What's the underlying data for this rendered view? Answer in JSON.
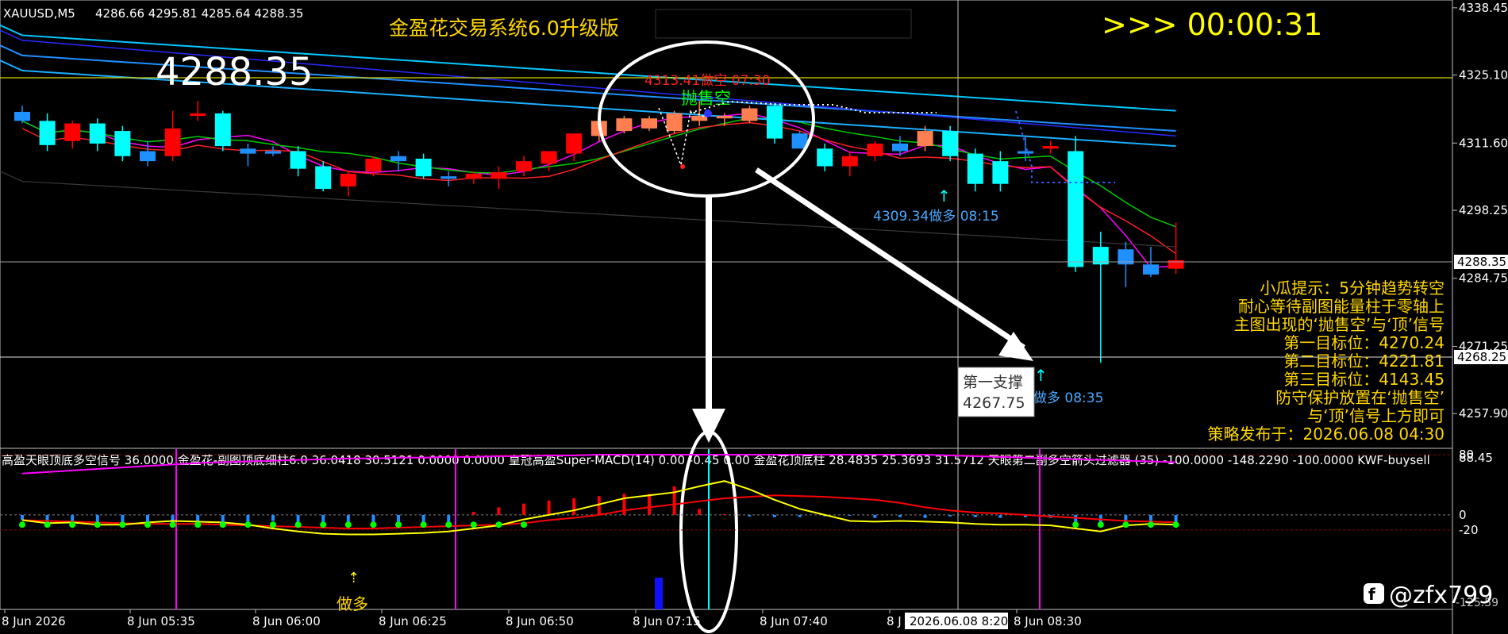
{
  "header": {
    "symbol": "XAUUSD,M5",
    "ohlc": "4286.66 4295.81 4285.64 4288.35",
    "system_title": "金盈花交易系统6.0升级版",
    "countdown": ">>> 00:00:31",
    "big_price": "4288.35"
  },
  "price_axis": {
    "ticks": [
      "4338.45",
      "4325.10",
      "4311.60",
      "4298.25",
      "4284.75",
      "4271.25",
      "4257.90"
    ],
    "current_tag": "4288.35",
    "line_tag": "4268.25"
  },
  "signals": {
    "sell_text": "4313.41做空 07:30",
    "sell_label": "抛售空",
    "buy1_text": "4309.34做多 08:15",
    "buy2_text": "做多 08:35",
    "support_title": "第一支撑",
    "support_value": "4267.75",
    "sub_buy_label": "做多"
  },
  "tips": {
    "line1": "小瓜提示：5分钟趋势转空",
    "line2": "耐心等待副图能量柱于零轴上",
    "line3": "主图出现的‘抛售空’与‘顶’信号",
    "line4": "第一目标位：4270.24",
    "line5": "第二目标位：4221.81",
    "line6": "第三目标位：4143.45",
    "line7": "防守保护放置在‘抛售空’",
    "line8": "与‘顶’信号上方即可",
    "line9": "策略发布于：2026.06.08 04:30"
  },
  "sub_header": "高盈天眼顶底多空信号 36.0000  金盈花-副图顶底细柱6.0 36.0418 30.5121 0.0000 0.0000  皇冠高盈Super-MACD(14) 0.00 -0.45 0.00  金盈花顶底柱 28.4835 25.3693 31.5712  天眼第二副多空箭头过滤器 (35) -100.0000 -148.2290 -100.0000  KWF-buysell",
  "sub_axis": {
    "ticks": [
      "88.45",
      "80",
      "0",
      "-20"
    ],
    "bottom": "-125.59"
  },
  "time_axis": {
    "labels": [
      "8 Jun 2026",
      "8 Jun 05:35",
      "8 Jun 06:00",
      "8 Jun 06:25",
      "8 Jun 06:50",
      "8 Jun 07:15",
      "8 Jun 07:40",
      "8 J",
      "8 Jun 08:30"
    ],
    "cursor_label": "2026.06.08 8:20"
  },
  "watermark": "@zfx799",
  "colors": {
    "up": "#ff0000",
    "down": "#1e90ff",
    "cyan": "#00ffff",
    "yellow": "#ffd700"
  },
  "chart_data": {
    "type": "candlestick",
    "timeframe": "M5",
    "candles": [
      {
        "o": 4317.8,
        "h": 4319.0,
        "l": 4315.5,
        "c": 4316.0
      },
      {
        "o": 4316.0,
        "h": 4317.5,
        "l": 4310.0,
        "c": 4311.2
      },
      {
        "o": 4312.0,
        "h": 4316.0,
        "l": 4310.5,
        "c": 4315.5
      },
      {
        "o": 4315.5,
        "h": 4316.5,
        "l": 4310.0,
        "c": 4311.5
      },
      {
        "o": 4314.0,
        "h": 4315.0,
        "l": 4308.0,
        "c": 4309.0
      },
      {
        "o": 4310.0,
        "h": 4312.0,
        "l": 4307.0,
        "c": 4308.0
      },
      {
        "o": 4309.0,
        "h": 4318.0,
        "l": 4308.0,
        "c": 4314.5
      },
      {
        "o": 4317.0,
        "h": 4320.0,
        "l": 4316.0,
        "c": 4317.5
      },
      {
        "o": 4317.5,
        "h": 4318.0,
        "l": 4310.0,
        "c": 4311.0
      },
      {
        "o": 4310.5,
        "h": 4311.5,
        "l": 4307.0,
        "c": 4309.5
      },
      {
        "o": 4310.0,
        "h": 4311.0,
        "l": 4309.0,
        "c": 4309.5
      },
      {
        "o": 4310.0,
        "h": 4311.0,
        "l": 4305.0,
        "c": 4306.5
      },
      {
        "o": 4307.0,
        "h": 4308.0,
        "l": 4302.0,
        "c": 4302.5
      },
      {
        "o": 4303.0,
        "h": 4306.0,
        "l": 4301.0,
        "c": 4305.5
      },
      {
        "o": 4306.0,
        "h": 4309.0,
        "l": 4305.0,
        "c": 4308.5
      },
      {
        "o": 4309.0,
        "h": 4310.0,
        "l": 4306.0,
        "c": 4308.0
      },
      {
        "o": 4308.5,
        "h": 4309.5,
        "l": 4304.5,
        "c": 4305.0
      },
      {
        "o": 4305.0,
        "h": 4306.0,
        "l": 4303.0,
        "c": 4304.5
      },
      {
        "o": 4304.5,
        "h": 4306.0,
        "l": 4303.5,
        "c": 4305.5
      },
      {
        "o": 4304.5,
        "h": 4307.0,
        "l": 4302.5,
        "c": 4305.8
      },
      {
        "o": 4306.0,
        "h": 4309.0,
        "l": 4305.0,
        "c": 4308.0
      },
      {
        "o": 4307.5,
        "h": 4310.0,
        "l": 4306.0,
        "c": 4310.0
      },
      {
        "o": 4309.5,
        "h": 4312.5,
        "l": 4308.0,
        "c": 4313.5
      },
      {
        "o": 4313.0,
        "h": 4316.0,
        "l": 4312.0,
        "c": 4316.0
      },
      {
        "o": 4314.0,
        "h": 4317.0,
        "l": 4313.5,
        "c": 4316.5
      },
      {
        "o": 4314.5,
        "h": 4317.0,
        "l": 4314.0,
        "c": 4316.5
      },
      {
        "o": 4314.0,
        "h": 4318.0,
        "l": 4313.5,
        "c": 4317.5
      },
      {
        "o": 4316.0,
        "h": 4320.0,
        "l": 4315.0,
        "c": 4317.0
      },
      {
        "o": 4316.5,
        "h": 4317.5,
        "l": 4315.0,
        "c": 4317.0
      },
      {
        "o": 4316.0,
        "h": 4319.0,
        "l": 4315.5,
        "c": 4318.5
      },
      {
        "o": 4319.0,
        "h": 4319.5,
        "l": 4311.5,
        "c": 4312.5
      },
      {
        "o": 4313.5,
        "h": 4314.0,
        "l": 4311.0,
        "c": 4310.5
      },
      {
        "o": 4310.5,
        "h": 4311.5,
        "l": 4306.0,
        "c": 4307.0
      },
      {
        "o": 4307.0,
        "h": 4310.0,
        "l": 4305.0,
        "c": 4309.0
      },
      {
        "o": 4309.0,
        "h": 4312.0,
        "l": 4308.0,
        "c": 4311.5
      },
      {
        "o": 4311.5,
        "h": 4313.0,
        "l": 4309.0,
        "c": 4310.0
      },
      {
        "o": 4311.0,
        "h": 4315.0,
        "l": 4310.0,
        "c": 4314.0
      },
      {
        "o": 4314.0,
        "h": 4315.0,
        "l": 4308.0,
        "c": 4309.0
      },
      {
        "o": 4309.5,
        "h": 4310.5,
        "l": 4302.0,
        "c": 4303.5
      },
      {
        "o": 4308.0,
        "h": 4310.0,
        "l": 4302.0,
        "c": 4303.5
      },
      {
        "o": 4310.0,
        "h": 4313.0,
        "l": 4308.0,
        "c": 4309.5
      },
      {
        "o": 4310.5,
        "h": 4312.0,
        "l": 4309.5,
        "c": 4311.0
      },
      {
        "o": 4310.0,
        "h": 4313.0,
        "l": 4286.0,
        "c": 4287.0
      },
      {
        "o": 4291.0,
        "h": 4294.0,
        "l": 4268.0,
        "c": 4287.5
      },
      {
        "o": 4290.5,
        "h": 4292.0,
        "l": 4283.0,
        "c": 4287.5
      },
      {
        "o": 4287.5,
        "h": 4291.0,
        "l": 4285.0,
        "c": 4285.5
      },
      {
        "o": 4286.66,
        "h": 4295.81,
        "l": 4285.64,
        "c": 4288.35
      }
    ],
    "ylim": [
      4251,
      4340
    ],
    "sub_window": {
      "ylim": [
        -125.59,
        88.45
      ],
      "hist": [
        -7,
        -10,
        -9,
        -9,
        -10,
        -9,
        -9,
        -9,
        -10,
        -9,
        -8,
        -9,
        -10,
        -9,
        -9,
        -9,
        -10,
        -9,
        4,
        10,
        15,
        19,
        22,
        25,
        28,
        28,
        38,
        8,
        1,
        -2,
        -3,
        -3,
        -2,
        -1,
        -4,
        -3,
        -4,
        -2,
        -3,
        -4,
        -3,
        -4,
        -9,
        -12,
        -13,
        -11,
        -11
      ],
      "yellow": [
        -7,
        -11,
        -10,
        -13,
        -13,
        -10,
        -8,
        -9,
        -10,
        -13,
        -18,
        -22,
        -25,
        -26,
        -26,
        -25,
        -24,
        -22,
        -18,
        -14,
        -6,
        0,
        6,
        14,
        22,
        26,
        30,
        38,
        45,
        34,
        20,
        8,
        0,
        -8,
        -9,
        -8,
        -9,
        -10,
        -12,
        -13,
        -13,
        -14,
        -18,
        -22,
        -14,
        -12,
        -13
      ],
      "red": [
        -7,
        -8,
        -9,
        -10,
        -11,
        -12,
        -12,
        -12,
        -13,
        -14,
        -15,
        -16,
        -17,
        -18,
        -18,
        -17,
        -16,
        -15,
        -14,
        -13,
        -11,
        -7,
        -4,
        0,
        6,
        10,
        14,
        18,
        22,
        24,
        26,
        25,
        24,
        22,
        20,
        16,
        10,
        6,
        3,
        2,
        0,
        -2,
        -4,
        -6,
        -8,
        -9,
        -10
      ],
      "magenta": [
        55,
        57,
        59,
        61,
        63,
        65,
        67,
        69,
        70,
        71,
        72,
        73,
        74,
        75,
        75,
        76,
        76,
        77,
        77,
        78,
        78,
        79,
        79,
        80,
        80,
        80,
        80,
        80,
        80,
        80,
        80,
        80,
        80,
        80,
        80,
        80,
        80,
        79,
        78,
        77,
        76,
        75,
        74,
        73,
        72,
        71,
        70
      ]
    }
  }
}
